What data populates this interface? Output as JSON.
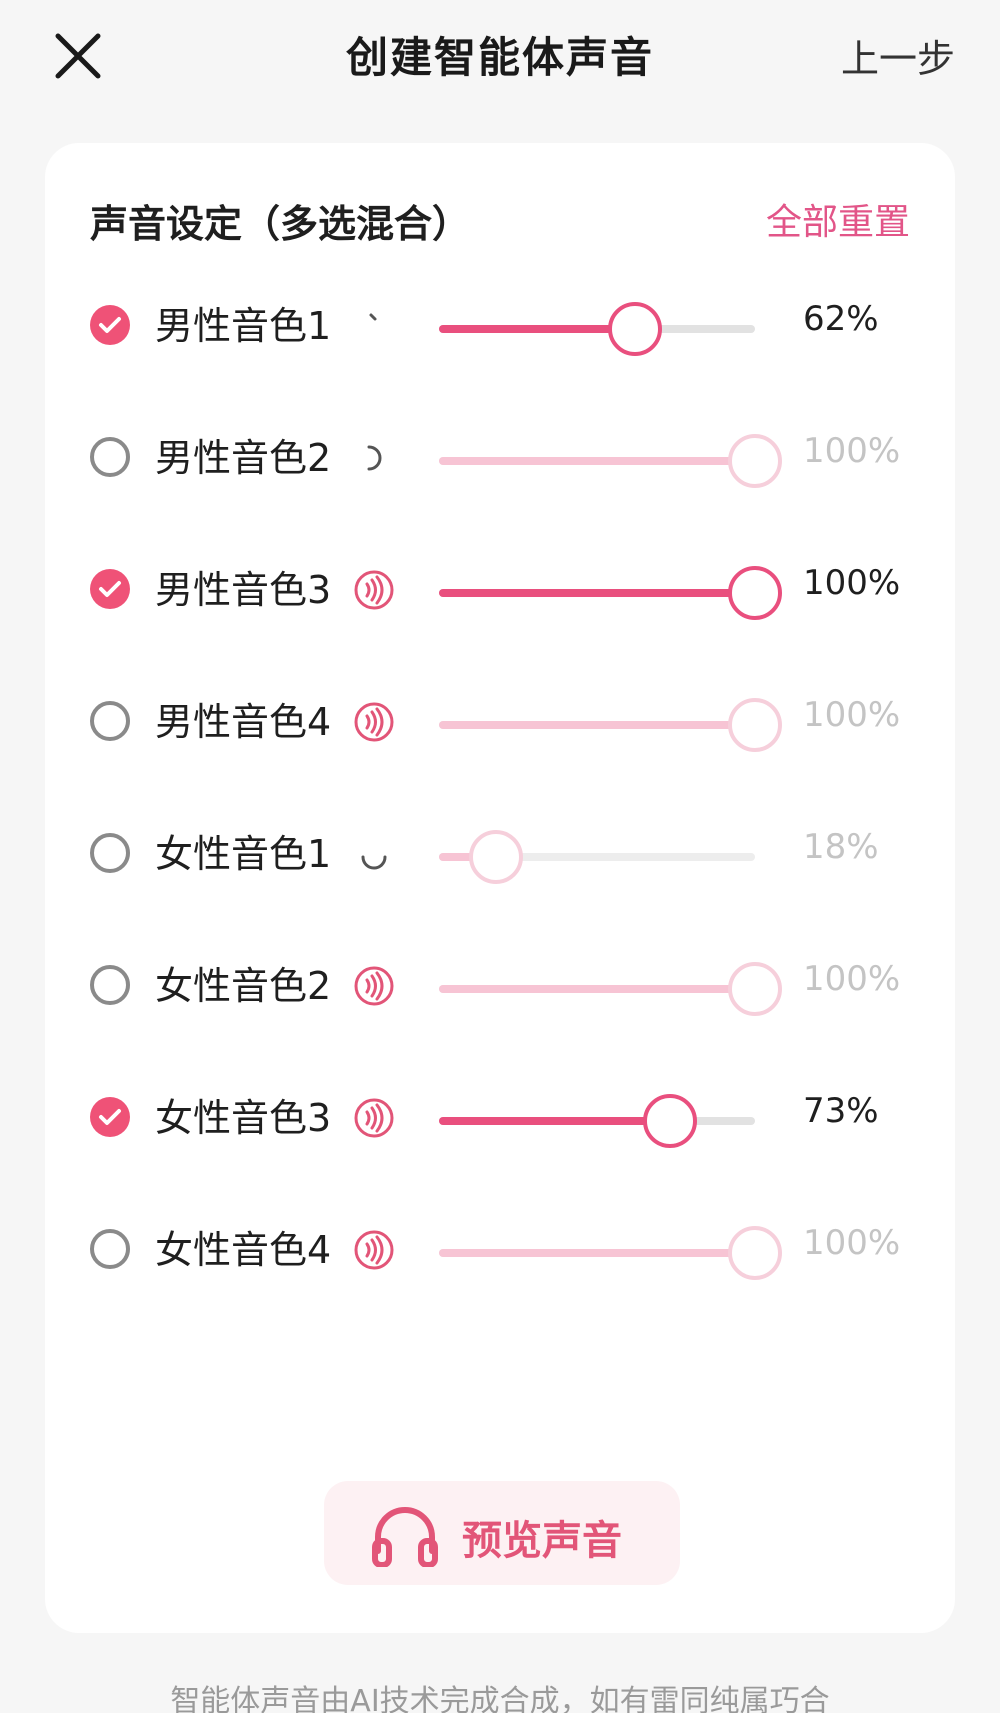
{
  "header": {
    "title": "创建智能体声音",
    "prev_step_label": "上一步"
  },
  "card": {
    "title": "声音设定（多选混合）",
    "reset_label": "全部重置"
  },
  "voices": [
    {
      "name": "男性音色1",
      "checked": true,
      "percent_label": "62%",
      "value": 62,
      "audio_icon": "loading-spinner-icon"
    },
    {
      "name": "男性音色2",
      "checked": false,
      "percent_label": "100%",
      "value": 100,
      "audio_icon": "loading-spinner-icon"
    },
    {
      "name": "男性音色3",
      "checked": true,
      "percent_label": "100%",
      "value": 100,
      "audio_icon": "sound-wave-icon"
    },
    {
      "name": "男性音色4",
      "checked": false,
      "percent_label": "100%",
      "value": 100,
      "audio_icon": "sound-wave-icon"
    },
    {
      "name": "女性音色1",
      "checked": false,
      "percent_label": "18%",
      "value": 18,
      "audio_icon": "loading-spinner-icon"
    },
    {
      "name": "女性音色2",
      "checked": false,
      "percent_label": "100%",
      "value": 100,
      "audio_icon": "sound-wave-icon"
    },
    {
      "name": "女性音色3",
      "checked": true,
      "percent_label": "73%",
      "value": 73,
      "audio_icon": "sound-wave-icon"
    },
    {
      "name": "女性音色4",
      "checked": false,
      "percent_label": "100%",
      "value": 100,
      "audio_icon": "sound-wave-icon"
    }
  ],
  "preview": {
    "label": "预览声音",
    "icon": "headphones-icon"
  },
  "footer": {
    "note": "智能体声音由AI技术完成合成，如有雷同纯属巧合"
  },
  "colors": {
    "accent": "#e94f7e",
    "accent_light": "#f7c4d4",
    "preview_bg": "#fdf1f3"
  }
}
